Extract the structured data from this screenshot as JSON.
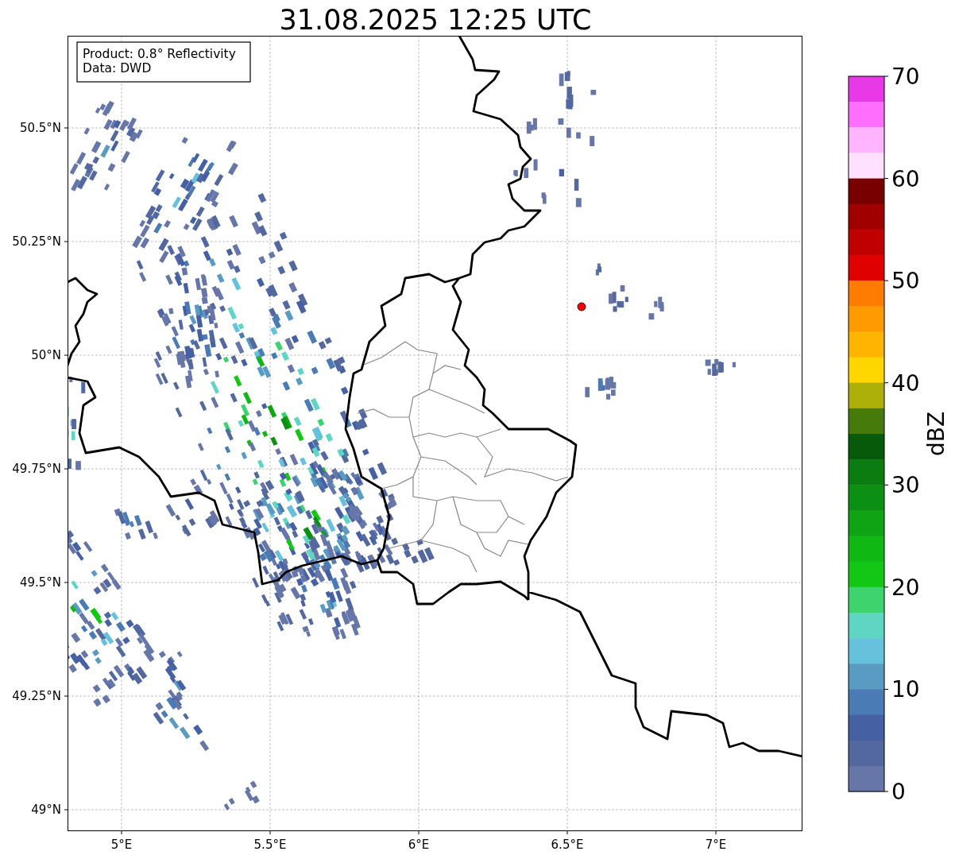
{
  "title": "31.08.2025 12:25 UTC",
  "info_box": {
    "lines": [
      "Product: 0.8° Reflectivity",
      "Data: DWD"
    ]
  },
  "map": {
    "yticks": [
      "50.5°N",
      "50.25°N",
      "50°N",
      "49.75°N",
      "49.5°N",
      "49.25°N",
      "49°N"
    ],
    "xticks": [
      "5°E",
      "5.5°E",
      "6°E",
      "6.5°E",
      "7°E"
    ]
  },
  "colorbar": {
    "label": "dBZ",
    "ticks": [
      "70",
      "60",
      "50",
      "40",
      "30",
      "20",
      "10",
      "0"
    ],
    "segments": [
      {
        "color": "#e838e8"
      },
      {
        "color": "#ff6eff"
      },
      {
        "color": "#ffb4ff"
      },
      {
        "color": "#ffe0ff"
      },
      {
        "color": "#780000"
      },
      {
        "color": "#a00000"
      },
      {
        "color": "#c00000"
      },
      {
        "color": "#e00000"
      },
      {
        "color": "#ff7c00"
      },
      {
        "color": "#ff9a00"
      },
      {
        "color": "#ffb400"
      },
      {
        "color": "#ffd600"
      },
      {
        "color": "#aeb00a"
      },
      {
        "color": "#467a0a"
      },
      {
        "color": "#065a0a"
      },
      {
        "color": "#0a7c10"
      },
      {
        "color": "#0c9014"
      },
      {
        "color": "#0ea414"
      },
      {
        "color": "#10b814"
      },
      {
        "color": "#12c814"
      },
      {
        "color": "#3dd46e"
      },
      {
        "color": "#5fd6c4"
      },
      {
        "color": "#66c2dc"
      },
      {
        "color": "#5a9bc4"
      },
      {
        "color": "#4a7bb4"
      },
      {
        "color": "#4660a4"
      },
      {
        "color": "#5468a0"
      },
      {
        "color": "#6676a8"
      }
    ]
  }
}
